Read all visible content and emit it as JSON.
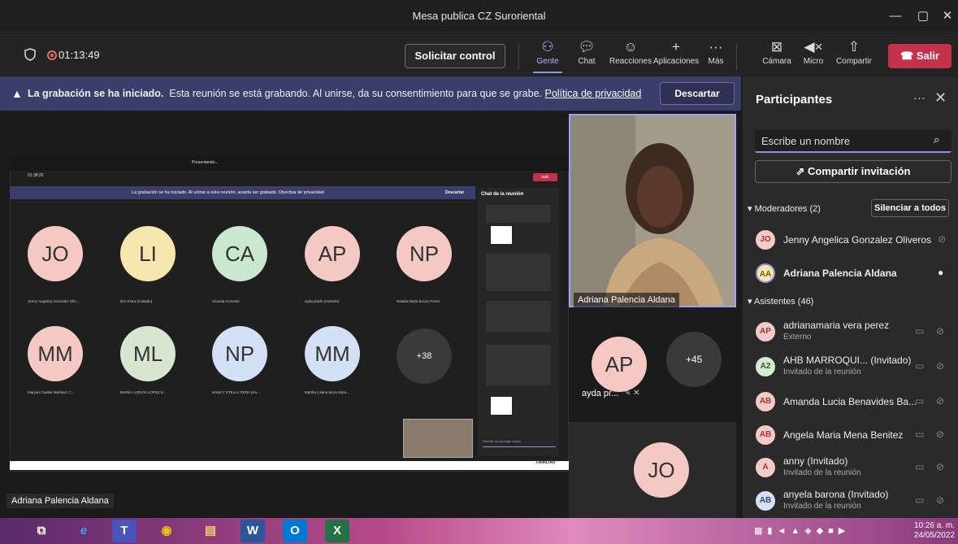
{
  "window": {
    "title": "Mesa publica CZ Suroriental",
    "minimize": "—",
    "maximize": "▢",
    "close": "✕"
  },
  "toolbar": {
    "timer": "01:13:49",
    "request_control": "Solicitar control",
    "people": "Gente",
    "chat": "Chat",
    "reactions": "Reacciones",
    "apps": "Aplicaciones",
    "more": "Más",
    "camera": "Cámara",
    "mic": "Micro",
    "share": "Compartir",
    "leave": "Salir"
  },
  "banner": {
    "title": "La grabación se ha iniciado.",
    "text": "Esta reunión se está grabando. Al unirse, da su consentimiento para que se grabe.",
    "link": "Política de privacidad",
    "dismiss": "Descartar"
  },
  "inner_share": {
    "title": "Presentando...",
    "timer": "01:38:20",
    "banner": "La grabación se ha iniciado. Al unirse a esta reunión, acepta ser grabado. Directiva de privacidad",
    "dismiss": "Descartar",
    "chat_title": "Chat de la reunión",
    "leave": "Salir",
    "footer": "FAMILIAR",
    "compose": "Escribir un mensaje nuevo",
    "bubbles": [
      {
        "initials": "JO",
        "name": "Jenny Angelica Gonzalez Oliv...",
        "color": "#f4c9c4"
      },
      {
        "initials": "LI",
        "name": "liza chara (Invitado)",
        "color": "#f6e7b0"
      },
      {
        "initials": "CA",
        "name": "Claudia Acevedo",
        "color": "#c9e8cf"
      },
      {
        "initials": "AP",
        "name": "ayda prado (Invitado)",
        "color": "#f4c9c4"
      },
      {
        "initials": "NP",
        "name": "Natalia Maria bocon Perez",
        "color": "#f4c9c4"
      },
      {
        "initials": "MM",
        "name": "Maryuri Cuellar Martinez C...",
        "color": "#f4c9c4"
      },
      {
        "initials": "ML",
        "name": "MARIA LUDIVIA LOPEZ E...",
        "color": "#d8e5d0"
      },
      {
        "initials": "NP",
        "name": "NANCY STELLA PEÑA (Inv...",
        "color": "#d3e0f5"
      },
      {
        "initials": "MM",
        "name": "Martha Liliana Mora Mora...",
        "color": "#d3e0f5"
      }
    ],
    "overflow": "+38"
  },
  "videos": {
    "main_label": "Adriana Palencia Aldana",
    "ap_initials": "AP",
    "ap_name": "ayda pr...",
    "overflow": "+45",
    "jo_initials": "JO",
    "speaker": "Adriana Palencia Aldana"
  },
  "sidebar": {
    "title": "Participantes",
    "more": "···",
    "close": "✕",
    "search_placeholder": "Escribe un nombre",
    "share_invite": "Compartir invitación",
    "moderators_header": "Moderadores (2)",
    "mute_all": "Silenciar a todos",
    "attendees_header": "Asistentes (46)",
    "moderators": [
      {
        "initials": "JO",
        "name": "Jenny Angelica Gonzalez Oliveros",
        "sub": ""
      },
      {
        "initials": "AA",
        "name": "Adriana Palencia Aldana",
        "sub": ""
      }
    ],
    "attendees": [
      {
        "initials": "AP",
        "name": "adrianamaria vera perez",
        "sub": "Externo"
      },
      {
        "initials": "A2",
        "name": "AHB MARROQUI... (Invitado)",
        "sub": "Invitado de la reunión"
      },
      {
        "initials": "AB",
        "name": "Amanda Lucia Benavides Ba...",
        "sub": ""
      },
      {
        "initials": "AB",
        "name": "Angela Maria Mena Benitez",
        "sub": ""
      },
      {
        "initials": "A",
        "name": "anny (Invitado)",
        "sub": "Invitado de la reunión"
      },
      {
        "initials": "AB",
        "name": "anyela barona (Invitado)",
        "sub": "Invitado de la reunión"
      }
    ]
  },
  "taskbar": {
    "time": "10:26 a. m.",
    "date": "24/05/2022"
  }
}
